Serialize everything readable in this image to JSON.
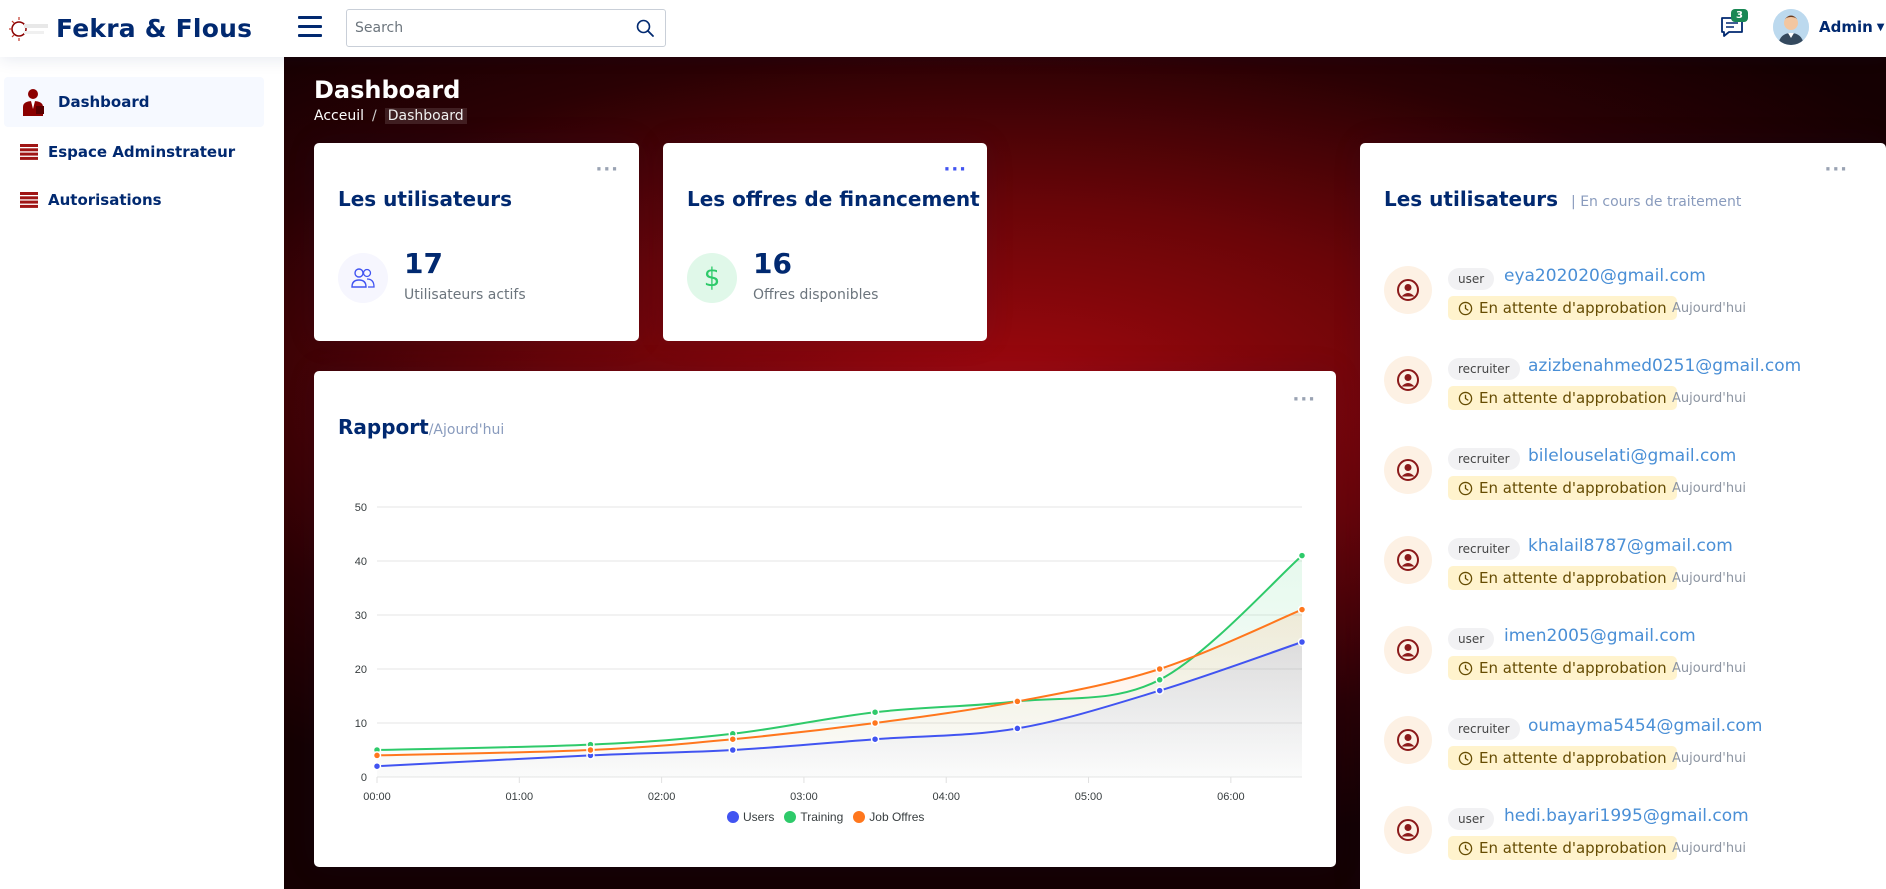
{
  "header": {
    "app_name": "Fekra & Flous",
    "search_placeholder": "Search",
    "notification_count": "3",
    "profile_name": "Admin"
  },
  "sidebar": {
    "items": [
      {
        "label": "Dashboard"
      },
      {
        "label": "Espace Adminstrateur"
      },
      {
        "label": "Autorisations"
      }
    ]
  },
  "page": {
    "title": "Dashboard",
    "breadcrumb": [
      "Acceuil",
      "/",
      "Dashboard"
    ]
  },
  "cards": {
    "users": {
      "title": "Les utilisateurs",
      "value": "17",
      "label": "Utilisateurs actifs"
    },
    "offers": {
      "title": "Les offres de financement",
      "value": "16",
      "label": "Offres disponibles",
      "icon": "$"
    }
  },
  "report": {
    "title": "Rapport",
    "subtitle": "/Ajourd'hui"
  },
  "chart_data": {
    "type": "area",
    "x": [
      "00:00",
      "01:30",
      "02:30",
      "03:30",
      "04:30",
      "05:30",
      "06:30"
    ],
    "xticks": [
      "00:00",
      "01:00",
      "02:00",
      "03:00",
      "04:00",
      "05:00",
      "06:00"
    ],
    "xlim": [
      0,
      6.5
    ],
    "ylim": [
      0,
      50
    ],
    "yticks": [
      "0",
      "10",
      "20",
      "30",
      "40",
      "50"
    ],
    "grid": true,
    "legend": "bottom-center",
    "series": [
      {
        "name": "Users",
        "color": "#4154f1",
        "values": [
          2,
          4,
          5,
          7,
          9,
          16,
          25
        ]
      },
      {
        "name": "Training",
        "color": "#2eca6a",
        "values": [
          5,
          6,
          8,
          12,
          14,
          18,
          41
        ]
      },
      {
        "name": "Job Offres",
        "color": "#ff771d",
        "values": [
          4,
          5,
          7,
          10,
          14,
          20,
          31
        ]
      }
    ]
  },
  "pending": {
    "title": "Les utilisateurs",
    "subtitle": "| En cours de traitement",
    "status_label": "En attente d'approbation",
    "time_label": "Aujourd'hui",
    "users": [
      {
        "role": "user",
        "email": "eya202020@gmail.com"
      },
      {
        "role": "recruiter",
        "email": "azizbenahmed0251@gmail.com"
      },
      {
        "role": "recruiter",
        "email": "bilelouselati@gmail.com"
      },
      {
        "role": "recruiter",
        "email": "khalail8787@gmail.com"
      },
      {
        "role": "user",
        "email": "imen2005@gmail.com"
      },
      {
        "role": "recruiter",
        "email": "oumayma5454@gmail.com"
      },
      {
        "role": "user",
        "email": "hedi.bayari1995@gmail.com"
      }
    ]
  }
}
